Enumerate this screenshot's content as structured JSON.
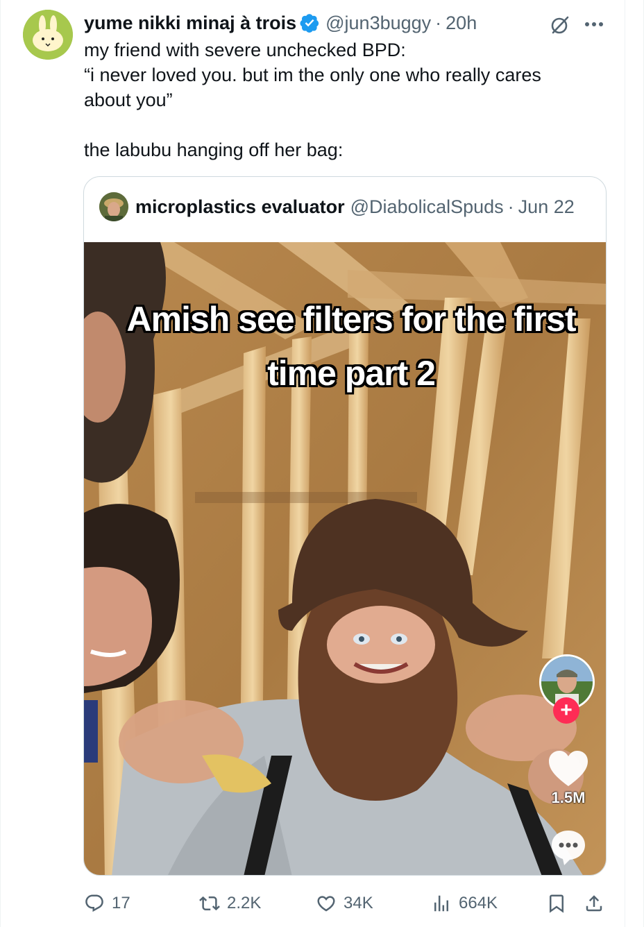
{
  "tweet": {
    "display_name": "yume nikki minaj à trois",
    "handle": "@jun3buggy",
    "separator": "·",
    "time": "20h",
    "text_lines": [
      "my friend with severe unchecked BPD:",
      "“i never loved you. but im the only one who really cares about you”",
      "",
      "the labubu hanging off her bag:"
    ]
  },
  "quote": {
    "display_name": "microplastics evaluator",
    "handle": "@DiabolicalSpuds",
    "separator": "·",
    "time": "Jun 22",
    "video_caption": "Amish see filters for the first time part 2",
    "tiktok": {
      "follow_plus": "+",
      "like_count": "1.5M"
    }
  },
  "actions": {
    "reply_count": "17",
    "retweet_count": "2.2K",
    "like_count": "34K",
    "views_count": "664K"
  },
  "icons": {
    "verified": "verified-badge-icon",
    "grok": "grok-icon",
    "more": "more-icon",
    "reply": "reply-icon",
    "retweet": "retweet-icon",
    "like": "heart-icon",
    "views": "views-icon",
    "bookmark": "bookmark-icon",
    "share": "share-icon"
  },
  "colors": {
    "verified_blue": "#1d9bf0",
    "secondary_text": "#536471",
    "primary_text": "#0f1419",
    "tiktok_red": "#fe2c55"
  }
}
